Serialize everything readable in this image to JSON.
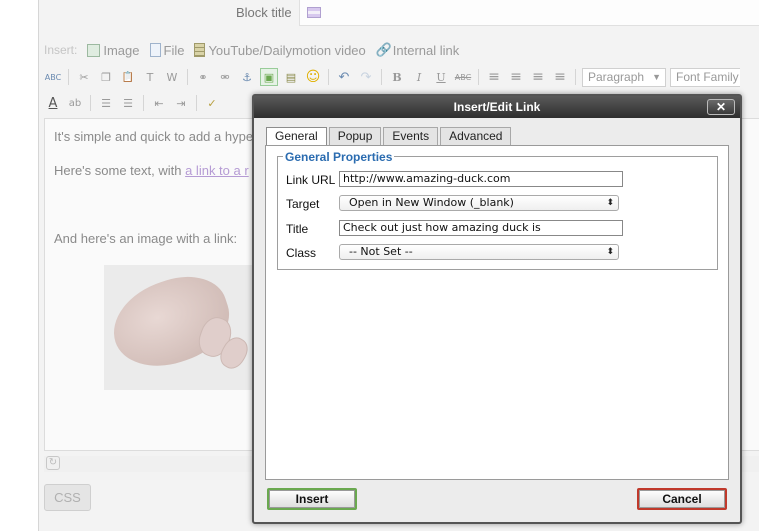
{
  "block_title": {
    "label": "Block title",
    "flag_icon": "uk-flag-icon"
  },
  "insert_bar": {
    "label": "Insert:",
    "items": [
      {
        "label": "Image",
        "icon": "image-icon"
      },
      {
        "label": "File",
        "icon": "file-icon"
      },
      {
        "label": "YouTube/Dailymotion video",
        "icon": "film-icon"
      },
      {
        "label": "Internal link",
        "icon": "link-icon"
      }
    ]
  },
  "toolbar": {
    "row1": {
      "spellcheck": "ABC",
      "cut": "✂",
      "copy": "❐",
      "paste": "📋",
      "paste_text": "T",
      "paste_word": "W",
      "link": "⚭",
      "unlink": "⚮",
      "anchor": "⚓",
      "image": "▣",
      "media": "▤",
      "emoticon": "☺",
      "undo": "↶",
      "redo": "↷",
      "bold": "B",
      "italic": "I",
      "underline": "U",
      "strikethrough": "ABC",
      "align_left": "≡",
      "align_center": "≡",
      "align_right": "≡",
      "align_justify": "≡",
      "format_select": "Paragraph",
      "font_select": "Font Family"
    },
    "row2": {
      "text_color": "A",
      "highlight": "ab",
      "bullet_list": "☰",
      "number_list": "☰",
      "outdent": "⇤",
      "indent": "⇥",
      "cleanup": "✓"
    }
  },
  "content": {
    "p1": "It's simple and quick to add a hype",
    "p2_prefix": "Here's some text, with ",
    "p2_link": "a link to a r",
    "p3": "And here's an image with a link:"
  },
  "bottom": {
    "resize_glyph": "↻",
    "css_button": "CSS"
  },
  "dialog": {
    "title": "Insert/Edit Link",
    "close": "✕",
    "tabs": [
      "General",
      "Popup",
      "Events",
      "Advanced"
    ],
    "active_tab": "General",
    "legend": "General Properties",
    "fields": {
      "link_url": {
        "label": "Link URL",
        "value": "http://www.amazing-duck.com"
      },
      "target": {
        "label": "Target",
        "value": "Open in New Window (_blank)"
      },
      "title": {
        "label": "Title",
        "value": "Check out just how amazing duck is"
      },
      "class": {
        "label": "Class",
        "value": "-- Not Set --"
      }
    },
    "insert_button": "Insert",
    "cancel_button": "Cancel"
  },
  "colors": {
    "legend_blue": "#2b6cb0",
    "insert_border": "#6aa84f",
    "cancel_border": "#c0392b",
    "titlebar": "#3a3a3a"
  }
}
